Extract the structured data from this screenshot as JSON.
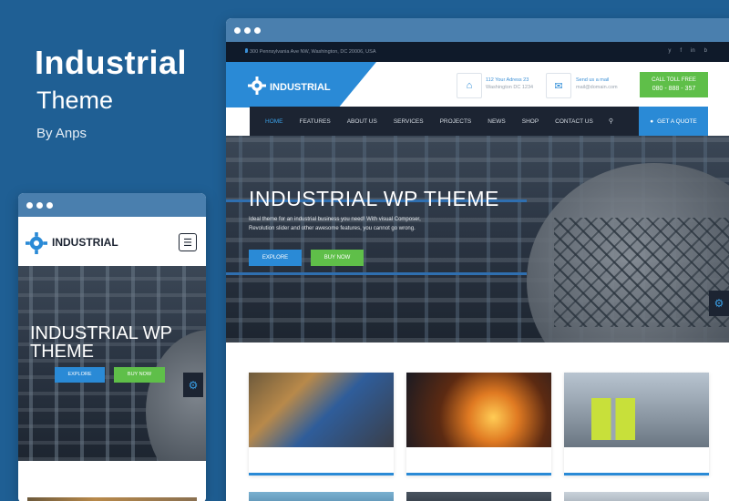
{
  "promo": {
    "title": "Industrial",
    "subtitle": "Theme",
    "by": "By Anps"
  },
  "desktop": {
    "topbar": {
      "address": "300 Pennsylvania Ave NW, Washington, DC 20006, USA",
      "social": [
        "y",
        "f",
        "in",
        "b"
      ]
    },
    "logo": "INDUSTRIAL",
    "info": [
      {
        "line1": "112 Your Adress 23",
        "line2": "Washington DC 1234",
        "icon": "home-icon"
      },
      {
        "line1": "Send us a mail",
        "line2": "mail@domain.com",
        "icon": "mail-icon"
      }
    ],
    "call": {
      "label": "CALL TOLL FREE",
      "number": "080 - 888 - 357"
    },
    "nav": [
      "HOME",
      "FEATURES",
      "ABOUT US",
      "SERVICES",
      "PROJECTS",
      "NEWS",
      "SHOP",
      "CONTACT US"
    ],
    "quote_label": "GET A QUOTE",
    "hero": {
      "title": "INDUSTRIAL WP THEME",
      "text": "Ideal theme for an industrial business you need! With visual Composer, Revolution slider and other awesome features, you cannot go wrong.",
      "explore": "EXPLORE",
      "buy": "BUY NOW"
    }
  },
  "mobile": {
    "logo": "INDUSTRIAL",
    "hero_title": "INDUSTRIAL WP THEME",
    "explore": "EXPLORE",
    "buy": "BUY NOW"
  },
  "colors": {
    "background": "#1f5f94",
    "accent_blue": "#2a8ad6",
    "accent_green": "#5fbf49",
    "nav_dark": "#1c2432"
  }
}
